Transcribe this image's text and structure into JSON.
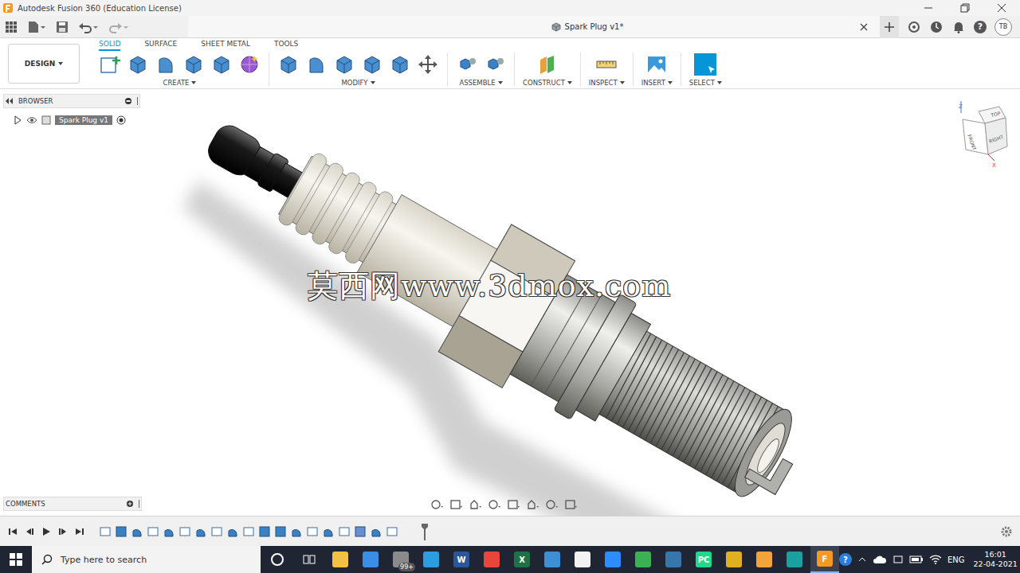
{
  "window": {
    "title": "Autodesk Fusion 360 (Education License)"
  },
  "document": {
    "title": "Spark Plug v1*"
  },
  "user": {
    "initials": "TB"
  },
  "help_glyph": "?",
  "workspace": "DESIGN",
  "ribbon_tabs": [
    {
      "label": "SOLID",
      "selected": true
    },
    {
      "label": "SURFACE",
      "selected": false
    },
    {
      "label": "SHEET METAL",
      "selected": false
    },
    {
      "label": "TOOLS",
      "selected": false
    }
  ],
  "ribbon_groups": [
    {
      "label": "CREATE",
      "highlighted": false,
      "tools": [
        "sketch",
        "extrude",
        "revolve",
        "hole",
        "pattern",
        "form"
      ]
    },
    {
      "label": "MODIFY",
      "highlighted": false,
      "tools": [
        "presspull",
        "fillet",
        "chamfer",
        "combine",
        "offset",
        "move"
      ]
    },
    {
      "label": "ASSEMBLE",
      "highlighted": false,
      "tools": [
        "component",
        "joint"
      ]
    },
    {
      "label": "CONSTRUCT",
      "highlighted": false,
      "tools": [
        "plane"
      ]
    },
    {
      "label": "INSPECT",
      "highlighted": false,
      "tools": [
        "measure"
      ]
    },
    {
      "label": "INSERT",
      "highlighted": false,
      "tools": [
        "image"
      ]
    },
    {
      "label": "SELECT",
      "highlighted": true,
      "tools": [
        "select"
      ]
    }
  ],
  "browser": {
    "title": "BROWSER",
    "items": [
      {
        "label": "Spark Plug v1",
        "expanded": false,
        "visible": true
      }
    ]
  },
  "comments": {
    "title": "COMMENTS"
  },
  "view_cube": {
    "faces": {
      "top": "TOP",
      "front": "FRONT",
      "right": "RIGHT"
    },
    "axes": {
      "z": "Z",
      "x": "X"
    }
  },
  "watermark": "莫西网www.3dmox.com",
  "nav_tools": [
    "orbit",
    "look-at",
    "pan",
    "zoom",
    "fit",
    "display",
    "grid",
    "viewports"
  ],
  "timeline": {
    "features": [
      "sketch",
      "extrude",
      "revolve",
      "sketch",
      "revolve",
      "sketch",
      "revolve",
      "sketch",
      "revolve",
      "sketch",
      "chamfer",
      "extrude",
      "fillet",
      "sketch",
      "revolve",
      "sketch",
      "combine",
      "revolve",
      "sketch"
    ]
  },
  "taskbar": {
    "search_placeholder": "Type here to search",
    "language": "ENG",
    "time": "16:01",
    "date": "22-04-2021",
    "apps": [
      {
        "kind": "explorer",
        "color": "#f3c244",
        "glyph": "",
        "badge": "",
        "active": false
      },
      {
        "kind": "store",
        "color": "#3a8ee6",
        "glyph": "",
        "badge": "",
        "active": false
      },
      {
        "kind": "mail",
        "color": "#8a8a8a",
        "glyph": "",
        "badge": "99+",
        "active": false
      },
      {
        "kind": "edge",
        "color": "#2c9ee0",
        "glyph": "",
        "badge": "",
        "active": false
      },
      {
        "kind": "word",
        "color": "#2b579a",
        "glyph": "W",
        "badge": "",
        "active": false
      },
      {
        "kind": "chrome",
        "color": "#e8453c",
        "glyph": "",
        "badge": "",
        "active": false
      },
      {
        "kind": "excel",
        "color": "#1e7145",
        "glyph": "X",
        "badge": "",
        "active": false
      },
      {
        "kind": "editor",
        "color": "#3d8fd6",
        "glyph": "",
        "badge": "",
        "active": false
      },
      {
        "kind": "document",
        "color": "#f2f2f2",
        "glyph": "",
        "badge": "",
        "active": false
      },
      {
        "kind": "zoom",
        "color": "#2d8cff",
        "glyph": "",
        "badge": "",
        "active": false
      },
      {
        "kind": "chart",
        "color": "#3cb054",
        "glyph": "",
        "badge": "",
        "active": false
      },
      {
        "kind": "python",
        "color": "#3776ab",
        "glyph": "",
        "badge": "",
        "active": false
      },
      {
        "kind": "pycharm",
        "color": "#21d789",
        "glyph": "PC",
        "badge": "",
        "active": false
      },
      {
        "kind": "tool",
        "color": "#e0b020",
        "glyph": "",
        "badge": "",
        "active": false
      },
      {
        "kind": "tool",
        "color": "#f2a33a",
        "glyph": "",
        "badge": "",
        "active": false
      },
      {
        "kind": "terminal",
        "color": "#1aa0a0",
        "glyph": "",
        "badge": "",
        "active": false
      },
      {
        "kind": "fusion",
        "color": "#f39a1f",
        "glyph": "F",
        "badge": "",
        "active": true
      }
    ]
  }
}
